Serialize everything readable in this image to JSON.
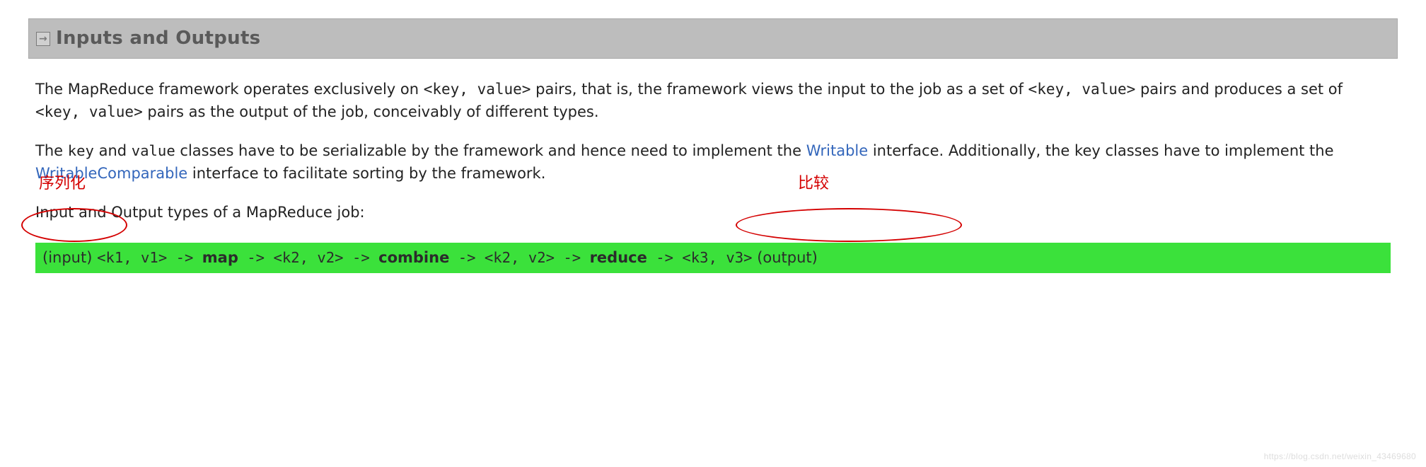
{
  "heading": {
    "title": "Inputs and Outputs"
  },
  "para1": {
    "t1": "The MapReduce framework operates exclusively on ",
    "kv1": "<key, value>",
    "t2": " pairs, that is, the framework views the input to the job as a set of ",
    "kv2": "<key, value>",
    "t3": " pairs and produces a set of ",
    "kv3": "<key, value>",
    "t4": " pairs as the output of the job, conceivably of different types."
  },
  "para2": {
    "t1": "The ",
    "c1": "key",
    "t2": " and ",
    "c2": "value",
    "t3": " classes have to be serializable by the framework and hence need to implement the ",
    "link1": "Writable",
    "t4": " interface. Additionally, the key classes have to implement the ",
    "link2": "WritableComparable",
    "t5": " interface to facilitate sorting by the framework."
  },
  "para3": "Input and Output types of a MapReduce job:",
  "flow": {
    "a": "(input) ",
    "k1": "<k1, v1>",
    "arr1": " -> ",
    "map": "map",
    "arr2": " -> ",
    "k2": "<k2, v2>",
    "arr3": " -> ",
    "combine": "combine",
    "arr4": " -> ",
    "k2b": "<k2, v2>",
    "arr5": " -> ",
    "reduce": "reduce",
    "arr6": " -> ",
    "k3": "<k3, v3>",
    "z": " (output)"
  },
  "annotations": {
    "serialize": "序列化",
    "compare": "比较"
  },
  "watermark": "https://blog.csdn.net/weixin_43469680"
}
